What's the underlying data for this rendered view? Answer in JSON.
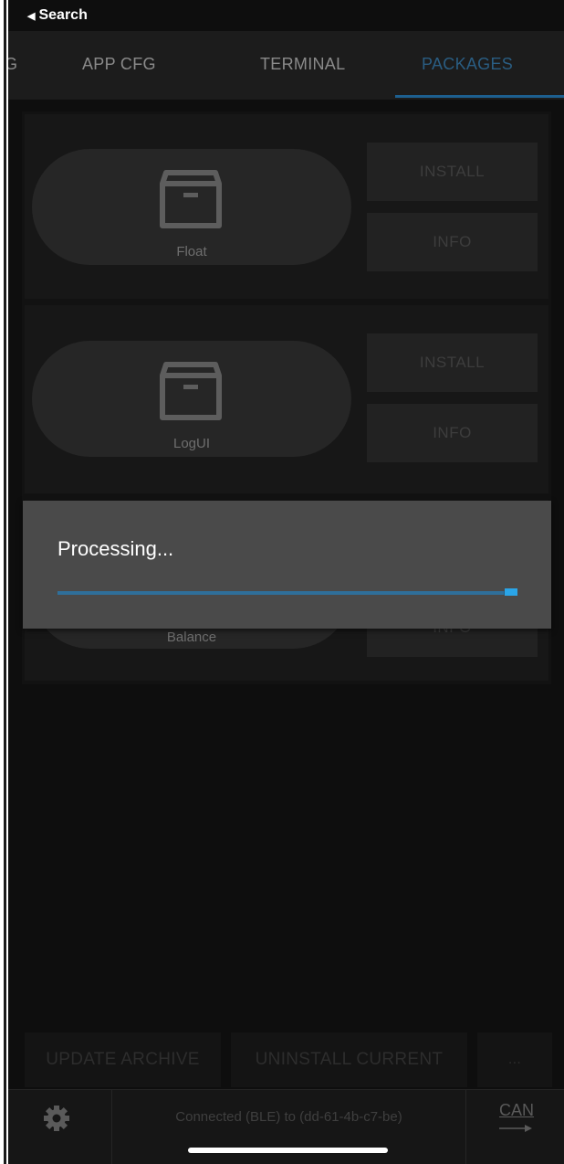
{
  "status": {
    "back_label": "Search"
  },
  "tabs": [
    {
      "label": "G"
    },
    {
      "label": "APP CFG"
    },
    {
      "label": "TERMINAL"
    },
    {
      "label": "PACKAGES"
    }
  ],
  "active_tab": "PACKAGES",
  "packages": [
    {
      "name": "Float",
      "install_label": "INSTALL",
      "info_label": "INFO"
    },
    {
      "name": "LogUI",
      "install_label": "INSTALL",
      "info_label": "INFO"
    },
    {
      "name": "Balance",
      "info_label": "INFO"
    }
  ],
  "dialog": {
    "title": "Processing...",
    "progress": 0.97
  },
  "actions": {
    "update_label": "UPDATE ARCHIVE",
    "uninstall_label": "UNINSTALL CURRENT",
    "more_label": "..."
  },
  "bottom_bar": {
    "connection_text": "Connected (BLE) to (dd-61-4b-c7-be)",
    "can_label": "CAN"
  },
  "colors": {
    "accent": "#2aa5e8",
    "background": "#0e0e0e",
    "dialog": "#4a4a4a"
  },
  "icons": [
    "back-arrow-icon",
    "package-box-icon",
    "gear-icon",
    "can-arrow-icon"
  ]
}
